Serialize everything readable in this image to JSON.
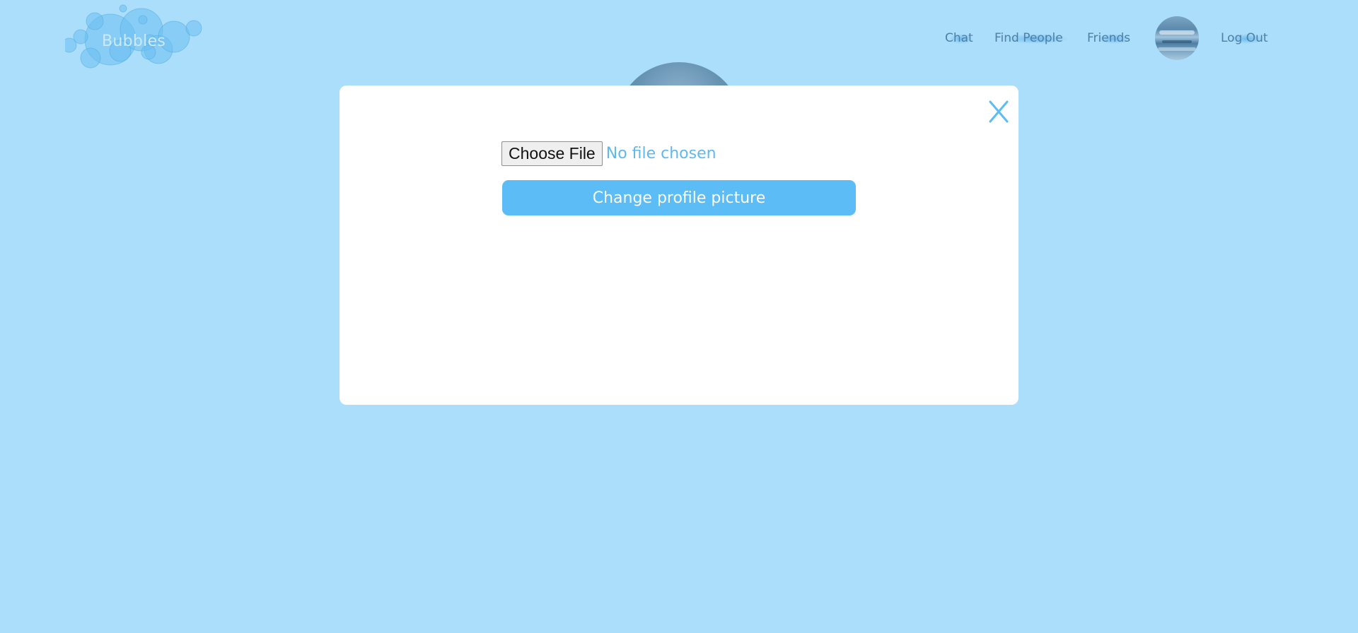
{
  "header": {
    "logo_text": "Bubbles",
    "nav": {
      "chat": "Chat",
      "find_people": "Find People",
      "friends": "Friends",
      "log_out": "Log Out"
    }
  },
  "modal": {
    "close_label": "X",
    "file_input": {
      "button_label": "Choose File",
      "status": "No file chosen"
    },
    "submit_label": "Change profile picture"
  },
  "colors": {
    "page_background": "#abdefa",
    "accent": "#5bbcf6",
    "nav_text": "#4f7fa3",
    "modal_background": "#ffffff"
  }
}
